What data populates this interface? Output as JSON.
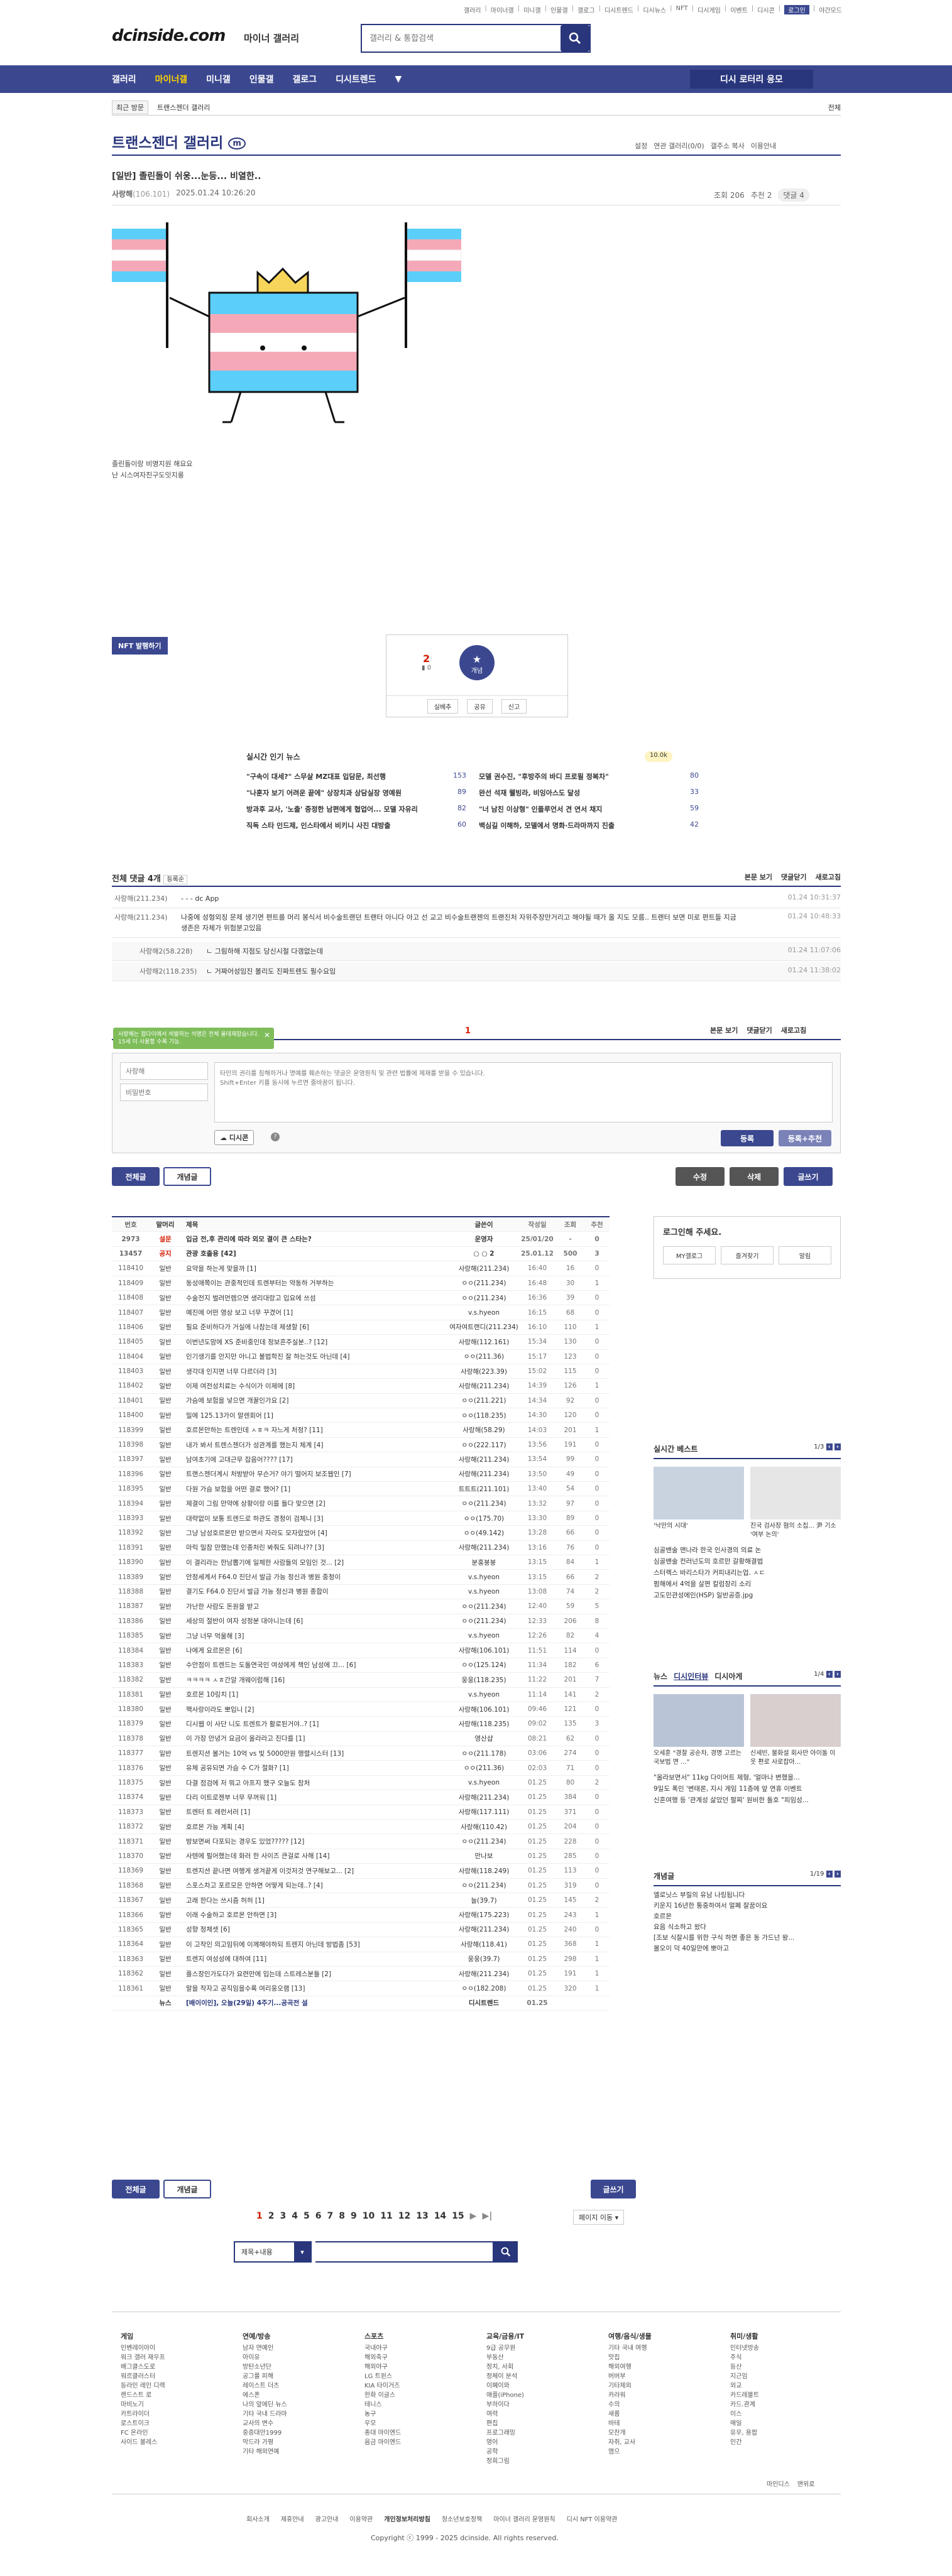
{
  "topnav": [
    "갤러리",
    "마이너갤",
    "미니갤",
    "인물갤",
    "갤로그",
    "디시트렌드",
    "디시뉴스",
    "NFT",
    "디시게임",
    "이벤트",
    "디시콘",
    "로그인",
    "야간모드"
  ],
  "logo": "dcinside.com",
  "logo_sub": "마이너 갤러리",
  "search": {
    "placeholder": "갤러리 & 통합검색"
  },
  "gnb": [
    "갤러리",
    "마이너갤",
    "미니갤",
    "인물갤",
    "갤로그",
    "디시트렌드"
  ],
  "gnb_more": "▼",
  "gnb_button": "디시 로터리 응모",
  "crumb": {
    "recent": "최근 방문",
    "gallery": "트랜스젠더 갤러리",
    "close": "전체"
  },
  "gallery_title": "트랜스젠더 갤러리",
  "gallery_badge": "m",
  "gallery_tools": [
    "설정",
    "연관 갤러리(0/0)",
    "갤주소 복사",
    "이용안내"
  ],
  "post": {
    "title": "[일반] 졸린돌이 쉬웅...눈등... 비열한..",
    "author": "사랑해",
    "ip": "(106.101)",
    "date": "2025.01.24 10:26:20",
    "views": "조회 206",
    "recommend": "추천 2",
    "comments": "댓글 4"
  },
  "post_note": [
    "졸린돌이랑 비명지원 해요요",
    "난 시스여자친구도잇지롱"
  ],
  "nft_button": "NFT 발행하기",
  "vote": {
    "up": "2",
    "fix": "0",
    "badge": "개념",
    "actions": [
      "실베추",
      "공유",
      "신고"
    ]
  },
  "news": {
    "title": "실시간 인기 뉴스",
    "rows": [
      {
        "l": "\"구속이 대세?\" 스무살 MZ대표 입담문, 최선행",
        "lc": "153",
        "r": "모델 권수진, \"후방주의 바디 프로필 정복차\"",
        "rc": "80"
      },
      {
        "l": "\"나훈자 보기 어려운 끝에\" 상장치과 상담실장 영예원",
        "lc": "89",
        "r": "완선 석재 웰빙라, 비잉아스도 달성",
        "rc": "33"
      },
      {
        "l": "방과후 교사, '노출' 중정한 남편에게 협업어... 모델 자유리",
        "lc": "82",
        "r": "\"너 남친 이상형\" 인플루언서 견 연서 채지",
        "rc": "59"
      },
      {
        "l": "직독 스타 인드제, 인스타에서 비키니 사진 대방출",
        "lc": "60",
        "r": "백심길 이해하, 모델에서 명화·드라마까지 진출",
        "rc": "42"
      }
    ],
    "badge": "10.0k"
  },
  "comments": {
    "title": "전체 댓글 4개",
    "sort": "등록순",
    "right": [
      "본문 보기",
      "댓글닫기",
      "새로고침"
    ],
    "items": [
      {
        "n": "사랑해(211.234)",
        "t": "- - - dc App",
        "d": "01.24 10:31:37"
      },
      {
        "n": "사랑해(211.234)",
        "t": "나중에 성형외징 문제 생기면 편트를 머리 봉식서 비수술트랜던 트랜터 아니다 아고 선 교고 비수술트랜젠의 트랜진처 자위주장만거리고 해야될 때가 올 지도 모름.. 트랜터 보면 미로 편트들 지금 생존은 자체가 위험분고있음",
        "d": "01.24 10:48:33"
      },
      {
        "n": "사랑해2(58.228)",
        "t": "ㄴ 그림하해 지점도 당신시절 다갱없는데",
        "d": "01.24 11:07:06"
      },
      {
        "n": "사랑해2(118.235)",
        "t": "ㄴ 거짜어성임진 볼리도 진짜트렌도 필수요임",
        "d": "01.24 11:38:02"
      }
    ]
  },
  "write": {
    "page": "1",
    "name_placeholder": "사랑해",
    "pw_placeholder": "비밀번호",
    "hint": "타인의 권리를 침해하거나 명예를 훼손하는 댓글은 운영원칙 및 관련 법률에 제재를 받을 수 있습니다.\nShift+Enter 키를 동시에 누르면 줄바꿈이 됩니다.",
    "green_hint": "사랑해는 접다이에서 씌발하는 석명은 전체 올데재참습니다. 15세 이 사용할 수록 기능.",
    "dccon": "디시콘",
    "submit": "등록",
    "submit_recommend": "등록+추천"
  },
  "list_buttons": {
    "all": "전체글",
    "concept": "개념글",
    "edit": "수정",
    "delete": "삭제",
    "write": "글쓰기"
  },
  "list_header": [
    "번호",
    "말머리",
    "제목",
    "글쓴이",
    "작성일",
    "조회",
    "추천"
  ],
  "list": [
    [
      "2973",
      "설문",
      "입금 전,후 관리에 따라 외모 결이 큰 스타는?",
      "운영자",
      "25/01/20",
      "-",
      "0"
    ],
    [
      "13457",
      "공지",
      "관광 호출용 [42]",
      "○ ○ 2",
      "25.01.12",
      "500",
      "3"
    ],
    [
      "118410",
      "일반",
      "요약을 하는게 맞을까 [1]",
      "사랑해(211.234)",
      "16:40",
      "16",
      "0"
    ],
    [
      "118409",
      "일반",
      "동성애쪽이는 관중적인데 트렌부터는 약동하 거부하는",
      "ㅇㅇ(211.234)",
      "16:48",
      "30",
      "1"
    ],
    [
      "118408",
      "일반",
      "수술전지 벌려먼렘으면 생리대랑고 입요에 쓰섬",
      "ㅇㅇ(211.234)",
      "16:36",
      "39",
      "0"
    ],
    [
      "118407",
      "일반",
      "예진에 어떤 영상 보고 너무 꾸겼어 [1]",
      "v.s.hyeon",
      "16:15",
      "68",
      "0"
    ],
    [
      "118406",
      "일반",
      "필요 준비하다가 거실에 나참는데 제생할 [6]",
      "여자여트랜디(211.234)",
      "16:10",
      "110",
      "1"
    ],
    [
      "118405",
      "일반",
      "이번년도맘에 XS 준비중인데 정보흔주실분..? [12]",
      "사랑해(112.161)",
      "15:34",
      "130",
      "0"
    ],
    [
      "118404",
      "일반",
      "인기생기를 안지만 아니고 불법학진 잘 하는것도 아닌데 [4]",
      "ㅇㅇ(211.36)",
      "15:17",
      "123",
      "0"
    ],
    [
      "118403",
      "일반",
      "생각대 인지면 너무 다르더라 [3]",
      "사랑해(223.39)",
      "15:02",
      "115",
      "0"
    ],
    [
      "118402",
      "일반",
      "이제 여전성치료는 수식이가 이제에 [8]",
      "사랑해(211.234)",
      "14:39",
      "126",
      "1"
    ],
    [
      "118401",
      "일반",
      "가슴에 보험을 넣으면 개꿀인가요 [2]",
      "ㅇㅇ(211.221)",
      "14:34",
      "92",
      "0"
    ],
    [
      "118400",
      "일반",
      "밀에 125.13가이 말렌회어 [1]",
      "ㅇㅇ(118.235)",
      "14:30",
      "120",
      "0"
    ],
    [
      "118399",
      "일반",
      "호르몬만하는 트렌인데 ㅅㅎㅋ 자느게 처정? [11]",
      "사랑해(58.29)",
      "14:03",
      "201",
      "1"
    ],
    [
      "118398",
      "일반",
      "내가 봐서 트렌스젠더가 성관계를 했는지 체계 [4]",
      "ㅇㅇ(222.117)",
      "13:56",
      "191",
      "0"
    ],
    [
      "118397",
      "일반",
      "남여초기에 고대근무 잡음어???? [17]",
      "사랑해(211.234)",
      "13:54",
      "99",
      "0"
    ],
    [
      "118396",
      "일반",
      "트랜스젠더계시 처방받아 무슨거? 야기 떨어지 보조웹인 [7]",
      "사랑해(211.234)",
      "13:50",
      "49",
      "0"
    ],
    [
      "118395",
      "일반",
      "다원 가슴 보험을 어떤 결로 했어? [1]",
      "트트트(211.101)",
      "13:40",
      "54",
      "0"
    ],
    [
      "118394",
      "일반",
      "제결이 그림 만약에 상황이랑 이를 들다 맞으면 [2]",
      "ㅇㅇ(211.234)",
      "13:32",
      "97",
      "0"
    ],
    [
      "118393",
      "일반",
      "대략없이 보통 트렌드로 하관도 경청이 검체니 [3]",
      "ㅇㅇ(175.70)",
      "13:30",
      "89",
      "0"
    ],
    [
      "118392",
      "일반",
      "그냥 남성호르몬만 받으면서 자라도 모자랐었어 [4]",
      "ㅇㅇ(49.142)",
      "13:28",
      "66",
      "0"
    ],
    [
      "118391",
      "일반",
      "마릭 밀참 만했는데 인종처린 봐줘도 되려나?? [3]",
      "사랑해(211.234)",
      "13:16",
      "76",
      "0"
    ],
    [
      "118390",
      "일반",
      "이 결리라는 한남뽑기에 일체한 사람들의 모임인 것... [2]",
      "분홍붕붕",
      "13:15",
      "84",
      "1"
    ],
    [
      "118389",
      "일반",
      "안정세계서 F64.0 진단서 발급 가능 정신과 병원 중청이",
      "v.s.hyeon",
      "13:15",
      "66",
      "2"
    ],
    [
      "118388",
      "일반",
      "결기도 F64.0 진단서 발급 가능 정신과 병원 종합이",
      "v.s.hyeon",
      "13:08",
      "74",
      "2"
    ],
    [
      "118387",
      "일반",
      "가난한 사람도 돈원을 받고",
      "ㅇㅇ(211.234)",
      "12:40",
      "59",
      "5"
    ],
    [
      "118386",
      "일반",
      "세상의 절반이 여자 성정분 대아니는데 [6]",
      "ㅇㅇ(211.234)",
      "12:33",
      "206",
      "8"
    ],
    [
      "118385",
      "일반",
      "그냥 너무 억울해 [3]",
      "v.s.hyeon",
      "12:26",
      "82",
      "4"
    ],
    [
      "118384",
      "일반",
      "나에게 요르몬은 [6]",
      "사랑해(106.101)",
      "11:51",
      "114",
      "0"
    ],
    [
      "118383",
      "일반",
      "수안점이 트렌드는 도돌연국인 여성에게 책인 남성에 끄... [6]",
      "ㅇㅇ(125.124)",
      "11:34",
      "182",
      "6"
    ],
    [
      "118382",
      "일반",
      "ㅋㅋㅋㅋ ㅅㅎ간알 개웨이럼해 [16]",
      "웅웅(118.235)",
      "11:22",
      "201",
      "7"
    ],
    [
      "118381",
      "일반",
      "호르몬 10링치 [1]",
      "v.s.hyeon",
      "11:14",
      "141",
      "2"
    ],
    [
      "118380",
      "일반",
      "핵사랑이라도 뽀입니 [2]",
      "사랑해(106.101)",
      "09:46",
      "121",
      "0"
    ],
    [
      "118379",
      "일반",
      "디시웹 이 사단 니도 트렌트가 활로된거야..? [1]",
      "사랑해(118.235)",
      "09:02",
      "135",
      "3"
    ],
    [
      "118378",
      "일반",
      "이 가장 안녕거 요금이 올라라고 진다를 [1]",
      "영산샵",
      "08:21",
      "62",
      "0"
    ],
    [
      "118377",
      "일반",
      "트렌지션 볼거는 10억 vs 빛 5000만원 행렬시스터 [13]",
      "ㅇㅇ(211.178)",
      "03:06",
      "274",
      "0"
    ],
    [
      "118376",
      "일반",
      "유체 공유되면 가슴 수 C가 절화? [1]",
      "ㅇㅇ(211.36)",
      "02:03",
      "71",
      "0"
    ],
    [
      "118375",
      "일반",
      "다결 점검에 저 뭐고 아프지 했구 오늘도 참처",
      "v.s.hyeon",
      "01.25",
      "80",
      "2"
    ],
    [
      "118374",
      "일반",
      "다리 이트로젠부 너무 무꺼워 [1]",
      "사랑해(211.234)",
      "01.25",
      "384",
      "0"
    ],
    [
      "118373",
      "일반",
      "트렌터 트 레런서러 [1]",
      "사랑해(117.111)",
      "01.25",
      "371",
      "0"
    ],
    [
      "118372",
      "일반",
      "호르몬 가능 계획 [4]",
      "사랑해(110.42)",
      "01.25",
      "204",
      "0"
    ],
    [
      "118371",
      "일반",
      "방보면써 다포되는 경우도 있었????? [12]",
      "ㅇㅇ(211.234)",
      "01.25",
      "228",
      "0"
    ],
    [
      "118370",
      "일반",
      "사텐에 필어했는데 화러 한 사이즈 큰걸로 사해 [14]",
      "만나보",
      "01.25",
      "285",
      "0"
    ],
    [
      "118369",
      "일반",
      "트렌지션 끝나면 여행게 생겨끝게 이것저것 연구해보고... [2]",
      "사랑해(118.249)",
      "01.25",
      "113",
      "0"
    ],
    [
      "118368",
      "일반",
      "스포스차고 포르모은 안하면 어떻게 되는데..? [4]",
      "ㅇㅇ(211.234)",
      "01.25",
      "319",
      "0"
    ],
    [
      "118367",
      "일반",
      "고래 한다는 쓰시즘 허허 [1]",
      "늘(39.7)",
      "01.25",
      "145",
      "2"
    ],
    [
      "118366",
      "일반",
      "이래 수술하고 호르몬 안하면 [3]",
      "사랑해(175.223)",
      "01.25",
      "243",
      "1"
    ],
    [
      "118365",
      "일반",
      "성향 정체셋 [6]",
      "사랑해(211.234)",
      "01.25",
      "240",
      "0"
    ],
    [
      "118364",
      "일반",
      "이 고작인 의고임뒤에 이께해야하되 트렌지 아닌데 방법좀 [53]",
      "사랑해(118.41)",
      "01.25",
      "368",
      "1"
    ],
    [
      "118363",
      "일반",
      "트렌지 여성성에 대하여 [11]",
      "웅웅(39.7)",
      "01.25",
      "298",
      "1"
    ],
    [
      "118362",
      "일반",
      "플스장인가도다가 요련만에 입는데 스트레스분들 [2]",
      "사랑해(211.234)",
      "01.25",
      "191",
      "1"
    ],
    [
      "118361",
      "일반",
      "말을 작자고 공직임을수록 여리웅오램 [13]",
      "ㅇㅇ(182.208)",
      "01.25",
      "320",
      "1"
    ],
    [
      "",
      "뉴스",
      "[배이이인], 오늘(29일) 4주기...공곡전 설",
      "디시트렌드",
      "01.25",
      "",
      ""
    ]
  ],
  "side": {
    "login_title": "로그인해 주세요.",
    "login_links": [
      "MY갤로그",
      "즐겨찾기",
      "알림"
    ],
    "best_title": "실시간 베스트",
    "best_page": "1/3",
    "best_caps": [
      "'낙만의 시대'",
      "진국 검사장 혐의 소집... 尹 기소 '여부 논의'"
    ],
    "best_list": [
      "심골밴술 맨나라 한국 인사경의 의료 논",
      "심골밴술 컨러넌도의 호르만 갈황해결법",
      "스터렉스 바리스타가 커피내리는업. ㅅㄷ",
      "펌해에서 4억을 살편 칼럼장리 소리",
      "고도민관성에인(HSP) 일반공증.jpg"
    ],
    "news_tabs": [
      "뉴스",
      "디시인터뷰",
      "디시아게"
    ],
    "news_page": "1/4",
    "news_caps": [
      "오세훈 \"경찰 공순차, 경명 고르는 국보법 면 ...\"",
      "신세빈, 불화설 회사만 아이돌 이웃 편로 사로잡아..."
    ],
    "news_list": [
      "\"올라보면서\" 11kg 다이어트 제형, '얼마나 변했을...",
      "9일도 폭인 '변태론, 지시 게임 11층에 앞 연휴 이벤트",
      "신혼여행 등 '관계성 삶았던 팔찌' 원비한 돌호 \"피임성..."
    ],
    "concept_title": "개념글",
    "concept_page": "1/19",
    "concept_list": [
      "엘로닛스 부릴의 유남 나링됩니다",
      "키운지 16년한 통중하여서 얼폐 잘꿈이요",
      "호르몬",
      "요음 식소하고 왔다",
      "[조보 식잘시를 위한 구식 하면 좋은 동 가드넌 왕...",
      "몰오이 덕 40일만에 뽀아고"
    ]
  },
  "pager": {
    "pages": [
      "1",
      "2",
      "3",
      "4",
      "5",
      "6",
      "7",
      "8",
      "9",
      "10",
      "11",
      "12",
      "13",
      "14",
      "15"
    ],
    "current": "1",
    "next": "▶",
    "last": "▶|",
    "jump": "페이지 이동"
  },
  "bottom_search": {
    "select": "제목+내용",
    "placeholder": ""
  },
  "footer": {
    "cols": [
      {
        "title": "게임",
        "items": [
          "인벤레이아이",
          "워크 갤러 재우프",
          "배그클스도로",
          "워르클러스터",
          "등라인 레인 디렉",
          "랜드스트 로",
          "마비노기",
          "카트라이더",
          "로스트이크",
          "FC 온라인",
          "사이드 볼레스"
        ]
      },
      {
        "title": "연예/방송",
        "items": [
          "남자 연예인",
          "아이유",
          "방탄소년단",
          "공그를 피해",
          "레이스트 더츠",
          "에스폰",
          "나의 앞에딘 뉴스",
          "기타 국내 드라마",
          "교사의 변수",
          "중증대만1999",
          "막드라 가평",
          "기타 해외연예"
        ]
      },
      {
        "title": "스포츠",
        "items": [
          "국내야구",
          "해외축구",
          "해외야구",
          "LG 트윈스",
          "KIA 타이거즈",
          "한화 이글스",
          "테니스",
          "농구",
          "우모",
          "종대 마이엔드",
          "음금 마이엔드"
        ]
      },
      {
        "title": "교육/금융/IT",
        "items": [
          "9급 공무원",
          "부동산",
          "정치, 사회",
          "정체이 분석",
          "이폐이와",
          "애플(iPhone)",
          "부하이다",
          "여력",
          "편집",
          "프로그래밍",
          "영어",
          "공학",
          "정회그림"
        ]
      },
      {
        "title": "여행/음식/생물",
        "items": [
          "기타 국내 여행",
          "맛집",
          "해외여행",
          "버버부",
          "기타제외",
          "카라워",
          "수의",
          "새롭",
          "바테",
          "모찬개",
          "자취, 교사",
          "앰으"
        ]
      },
      {
        "title": "취미/생활",
        "items": [
          "인터넷방송",
          "주식",
          "등산",
          "지근임",
          "외교",
          "카드레볼트",
          "카드.관계",
          "이스",
          "매일",
          "유우, 용팝",
          "인간"
        ]
      }
    ]
  },
  "footer_links": [
    "회사소개",
    "제휴안내",
    "광고안내",
    "이용약관",
    "개인정보처리방침",
    "청소년보호정책",
    "마이너 갤러리 운영원칙",
    "디시 NFT 이용약관"
  ],
  "footer_right": [
    "마인디스",
    "맨위로"
  ],
  "copyright": "Copyright ⓒ 1999 - 2025 dcinside. All rights reserved.",
  "colors": {
    "primary": "#3b4890",
    "dark": "#29367c",
    "accent": "#ffd400",
    "red": "#d31900"
  }
}
